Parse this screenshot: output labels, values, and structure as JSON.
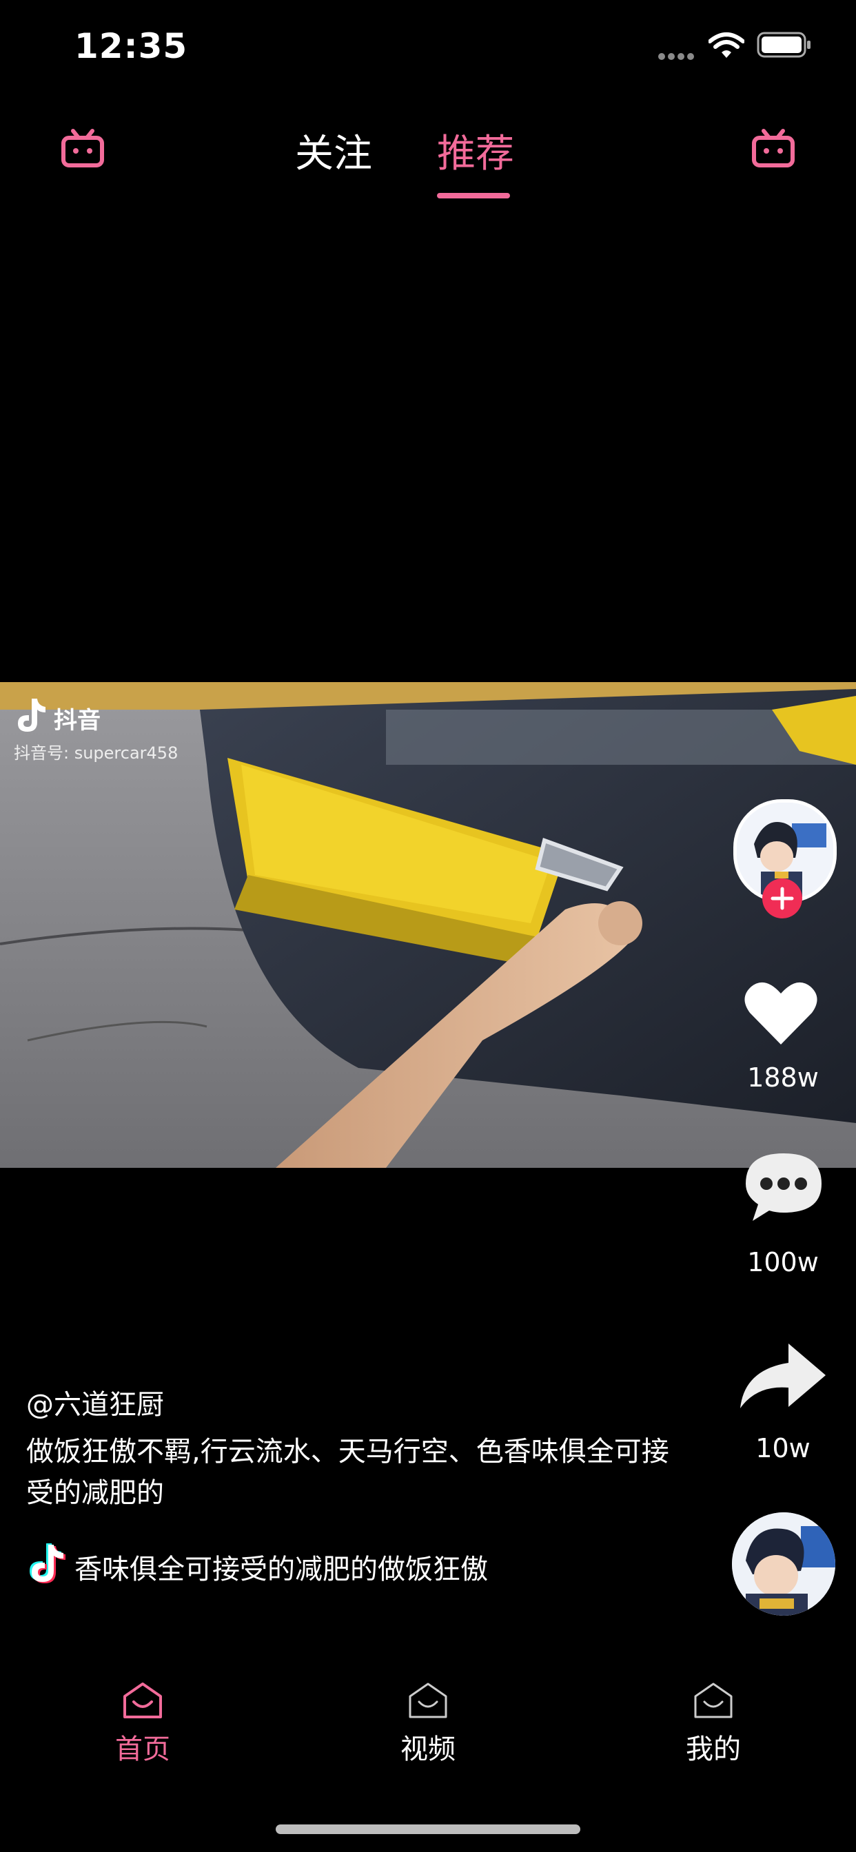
{
  "status_bar": {
    "time": "12:35"
  },
  "top_tabs": {
    "follow": "关注",
    "recommend": "推荐"
  },
  "video": {
    "watermark_brand": "抖音",
    "watermark_id": "抖音号: supercar458"
  },
  "actions": {
    "likes": "188w",
    "comments": "100w",
    "shares": "10w"
  },
  "post": {
    "author": "@六道狂厨",
    "description": "做饭狂傲不羁,行云流水、天马行空、色香味俱全可接受的减肥的",
    "music_marquee": "香味俱全可接受的减肥的做饭狂傲"
  },
  "bottom_nav": [
    {
      "label": "首页",
      "active": true
    },
    {
      "label": "视频",
      "active": false
    },
    {
      "label": "我的",
      "active": false
    }
  ],
  "colors": {
    "accent": "#f26b9a",
    "follow_plus": "#f02d55"
  }
}
